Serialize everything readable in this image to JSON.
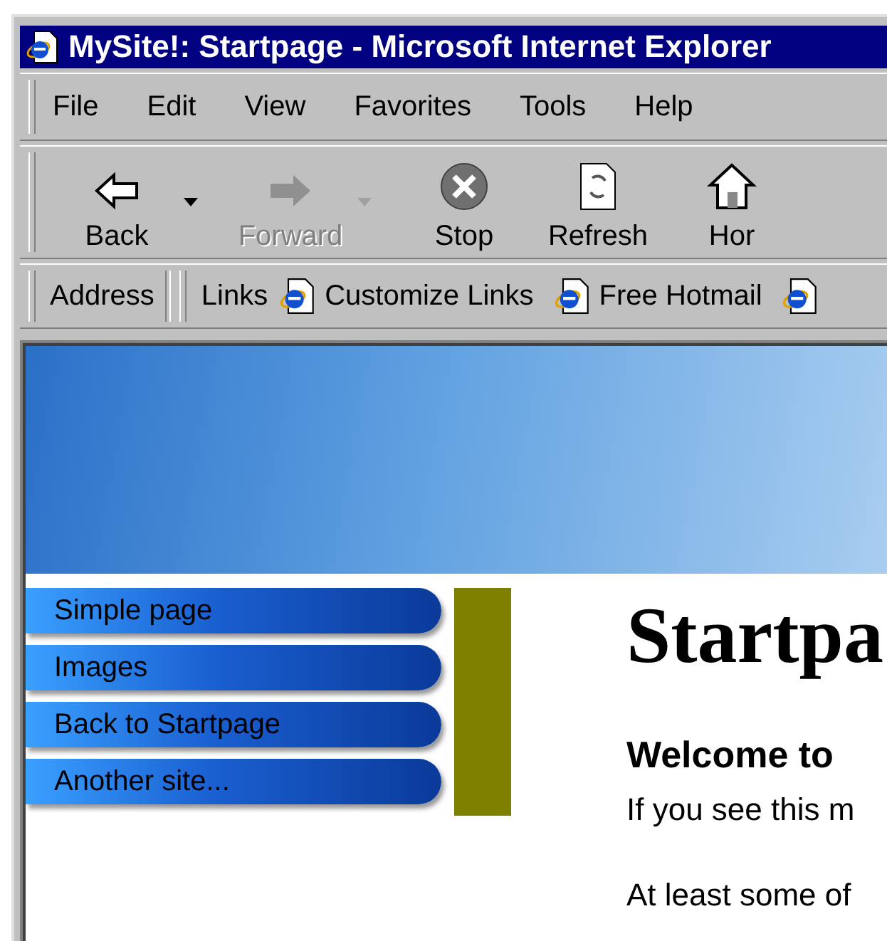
{
  "window": {
    "title": "MySite!: Startpage - Microsoft Internet Explorer"
  },
  "menu": [
    "File",
    "Edit",
    "View",
    "Favorites",
    "Tools",
    "Help"
  ],
  "toolbar": [
    {
      "kind": "back",
      "label": "Back",
      "disabled": false,
      "dropdown": true
    },
    {
      "kind": "forward",
      "label": "Forward",
      "disabled": true,
      "dropdown": true
    },
    {
      "kind": "stop",
      "label": "Stop",
      "disabled": false,
      "dropdown": false
    },
    {
      "kind": "refresh",
      "label": "Refresh",
      "disabled": false,
      "dropdown": false
    },
    {
      "kind": "home",
      "label": "Hor",
      "disabled": false,
      "dropdown": false
    }
  ],
  "address_bar": {
    "label": "Address"
  },
  "links_bar": {
    "label": "Links",
    "items": [
      {
        "kind": "link",
        "label": "Customize Links"
      },
      {
        "kind": "link",
        "label": "Free Hotmail"
      },
      {
        "kind": "icon"
      }
    ]
  },
  "page": {
    "nav": [
      "Simple page",
      "Images",
      "Back to Startpage",
      "Another site..."
    ],
    "heading": "Startpa",
    "subheading": "Welcome to",
    "paragraphs": [
      "If you see this m",
      "At least some of"
    ]
  }
}
